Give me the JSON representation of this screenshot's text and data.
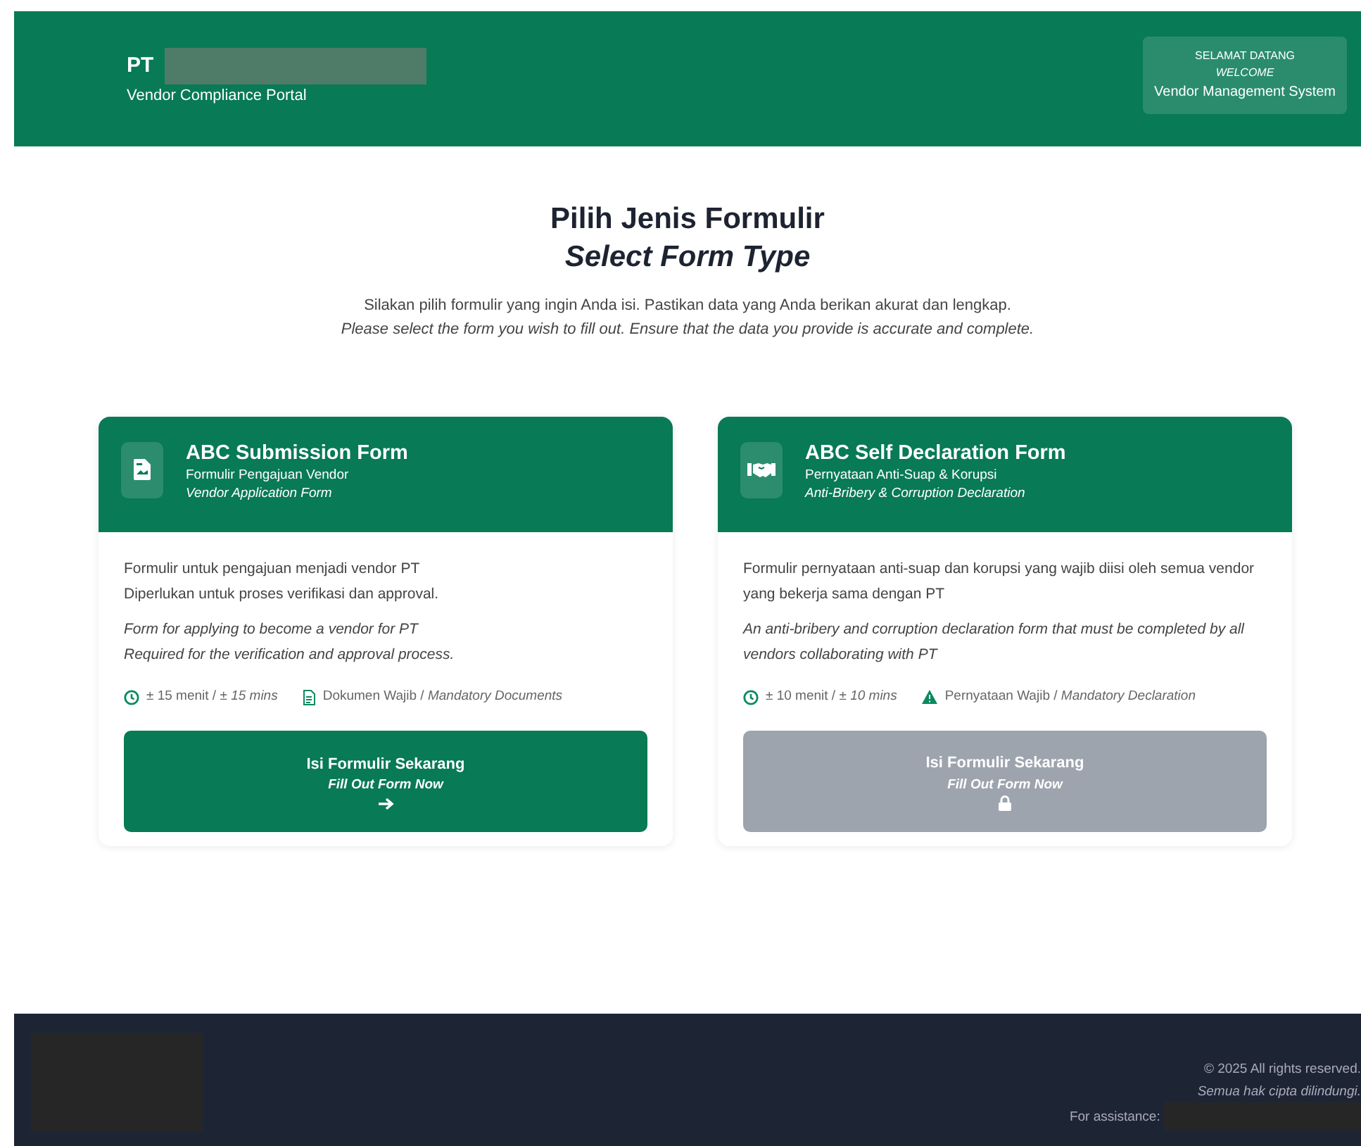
{
  "header": {
    "company": "PT",
    "company_redacted": true,
    "subtitle": "Vendor Compliance Portal",
    "welcome": {
      "line_1": "SELAMAT DATANG",
      "line_2": "WELCOME",
      "line_3": "Vendor Management System"
    }
  },
  "intro": {
    "title": "Pilih Jenis Formulir",
    "title_en": "Select Form Type",
    "text": "Silakan pilih formulir yang ingin Anda isi. Pastikan data yang Anda berikan akurat dan lengkap.",
    "text_en": "Please select the form you wish to fill out. Ensure that the data you provide is accurate and complete."
  },
  "forms": [
    {
      "kind": "document",
      "title": "ABC Submission Form",
      "subtitle": "Formulir Pengajuan Vendor",
      "subtitle_en": "Vendor Application Form",
      "description": [
        "Formulir untuk pengajuan menjadi vendor PT",
        "Diperlukan untuk proses verifikasi dan approval."
      ],
      "description_en": [
        "Form for applying to become a vendor for PT",
        "Required for the verification and approval process."
      ],
      "duration": "± 15 menit / ",
      "duration_en": "± 15 mins",
      "requirement": {
        "kind": "document",
        "text": "Dokumen Wajib / ",
        "text_en": "Mandatory Documents"
      },
      "button": "Isi Formulir Sekarang",
      "button_en": "Fill Out Form Now",
      "locked": false
    },
    {
      "kind": "handshake",
      "title": "ABC Self Declaration Form",
      "subtitle": "Pernyataan Anti-Suap & Korupsi",
      "subtitle_en": "Anti-Bribery & Corruption Declaration",
      "description": [
        "Formulir pernyataan anti-suap dan korupsi yang wajib diisi oleh semua vendor yang bekerja sama dengan PT"
      ],
      "description_en": [
        "An anti-bribery and corruption declaration form that must be completed by all vendors collaborating with PT"
      ],
      "duration": "± 10 menit / ",
      "duration_en": "± 10 mins",
      "requirement": {
        "kind": "warning",
        "text": "Pernyataan Wajib / ",
        "text_en": "Mandatory Declaration"
      },
      "button": "Isi Formulir Sekarang",
      "button_en": "Fill Out Form Now",
      "locked": true
    }
  ],
  "footer": {
    "logo_redacted": true,
    "copyright": "© 2025 All rights reserved.",
    "copyright_id": "Semua hak cipta dilindungi.",
    "assistance": "For assistance:",
    "assistance_redacted": true
  }
}
